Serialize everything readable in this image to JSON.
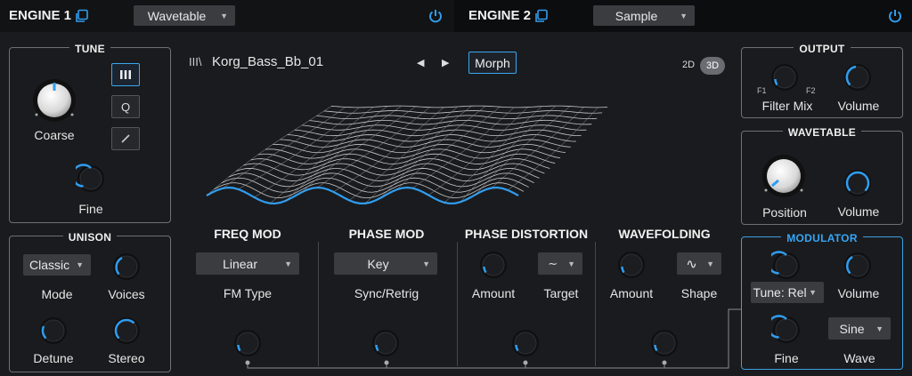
{
  "engine1": {
    "title": "ENGINE 1",
    "type": "Wavetable",
    "icons": {
      "copy": "copy-icon",
      "power": "power-icon"
    },
    "accent": "#2f9df0"
  },
  "engine2": {
    "title": "ENGINE 2",
    "type": "Sample"
  },
  "tune": {
    "title": "TUNE",
    "coarse_label": "Coarse",
    "fine_label": "Fine",
    "btn_q": "Q"
  },
  "unison": {
    "title": "UNISON",
    "mode_value": "Classic",
    "mode_label": "Mode",
    "voices_label": "Voices",
    "detune_label": "Detune",
    "stereo_label": "Stereo"
  },
  "wavetable_display": {
    "name": "Korg_Bass_Bb_01",
    "morph_label": "Morph",
    "view_2d": "2D",
    "view_3d": "3D",
    "active_view": "3D"
  },
  "freq_mod": {
    "title": "FREQ MOD",
    "type_value": "Linear",
    "type_label": "FM Type"
  },
  "phase_mod": {
    "title": "PHASE MOD",
    "sync_value": "Key",
    "sync_label": "Sync/Retrig"
  },
  "phase_distortion": {
    "title": "PHASE DISTORTION",
    "amount_label": "Amount",
    "target_label": "Target"
  },
  "wavefolding": {
    "title": "WAVEFOLDING",
    "amount_label": "Amount",
    "shape_label": "Shape"
  },
  "output": {
    "title": "OUTPUT",
    "filter_mix_label": "Filter Mix",
    "f1": "F1",
    "f2": "F2",
    "volume_label": "Volume"
  },
  "wavetable": {
    "title": "WAVETABLE",
    "position_label": "Position",
    "volume_label": "Volume"
  },
  "modulator": {
    "title": "MODULATOR",
    "tune_value": "Tune: Rel",
    "volume_label": "Volume",
    "fine_label": "Fine",
    "wave_value": "Sine",
    "wave_label": "Wave"
  }
}
